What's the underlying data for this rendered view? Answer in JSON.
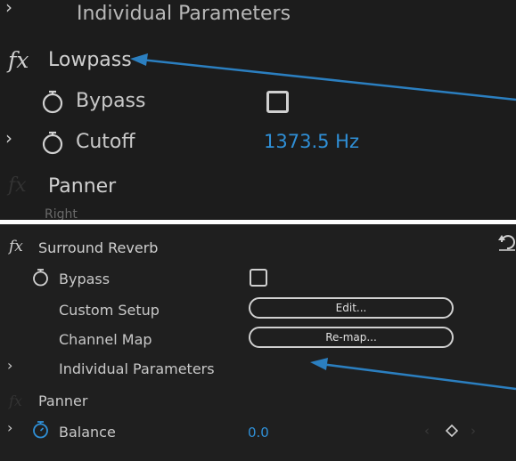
{
  "top": {
    "header_label": "Individual Parameters",
    "effect": {
      "fx_icon": "fx",
      "name": "Lowpass"
    },
    "bypass": {
      "label": "Bypass",
      "checked": false
    },
    "cutoff": {
      "label": "Cutoff",
      "value": "1373.5 Hz"
    },
    "panner_label": "Panner",
    "cutoff_text_fragment": "Right"
  },
  "bottom": {
    "effect": {
      "fx_icon": "fx",
      "name": "Surround Reverb"
    },
    "bypass": {
      "label": "Bypass",
      "checked": false
    },
    "custom_setup": {
      "label": "Custom Setup",
      "button": "Edit..."
    },
    "channel_map": {
      "label": "Channel Map",
      "button": "Re-map..."
    },
    "individual_parameters_label": "Individual Parameters",
    "panner_label": "Panner",
    "balance": {
      "label": "Balance",
      "value": "0.0"
    }
  },
  "colors": {
    "panel_bg": "#1e1e1e",
    "value_blue": "#2f8fd6",
    "arrow_blue": "#2b7fc0",
    "text": "#c8c8c8"
  },
  "icons": [
    "stopwatch-icon",
    "chevron-right-icon",
    "fx-icon",
    "reset-icon",
    "keyframe-diamond-icon"
  ]
}
